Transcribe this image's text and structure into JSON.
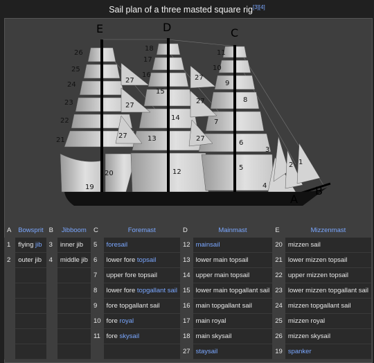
{
  "caption": {
    "text": "Sail plan of a three masted square rig",
    "refs": "[3][4]"
  },
  "diagram": {
    "mast_labels": [
      "E",
      "D",
      "C"
    ],
    "end_labels": [
      "A",
      "B"
    ],
    "sail_numbers": [
      "26",
      "25",
      "24",
      "23",
      "22",
      "21",
      "20",
      "19",
      "27",
      "27",
      "27",
      "18",
      "17",
      "16",
      "15",
      "14",
      "13",
      "12",
      "27",
      "27",
      "27",
      "11",
      "10",
      "9",
      "8",
      "7",
      "6",
      "5",
      "4",
      "3",
      "2",
      "1"
    ]
  },
  "table": {
    "headers": [
      {
        "letter": "A",
        "name": "Bowsprit"
      },
      {
        "letter": "B",
        "name": "Jibboom"
      },
      {
        "letter": "C",
        "name": "Foremast"
      },
      {
        "letter": "D",
        "name": "Mainmast"
      },
      {
        "letter": "E",
        "name": "Mizzenmast"
      }
    ],
    "rows": [
      [
        {
          "n": "1",
          "t": "flying",
          "l": "jib"
        },
        {
          "n": "3",
          "t": "inner jib"
        },
        {
          "n": "5",
          "t": "",
          "l": "foresail"
        },
        {
          "n": "12",
          "t": "",
          "l": "mainsail"
        },
        {
          "n": "20",
          "t": "mizzen sail"
        }
      ],
      [
        {
          "n": "2",
          "t": "outer jib"
        },
        {
          "n": "4",
          "t": "middle jib"
        },
        {
          "n": "6",
          "t": "lower fore",
          "l": "topsail"
        },
        {
          "n": "13",
          "t": "lower main topsail"
        },
        {
          "n": "21",
          "t": "lower mizzen topsail"
        }
      ],
      [
        null,
        null,
        {
          "n": "7",
          "t": "upper fore topsail"
        },
        {
          "n": "14",
          "t": "upper main topsail"
        },
        {
          "n": "22",
          "t": "upper mizzen topsail"
        }
      ],
      [
        null,
        null,
        {
          "n": "8",
          "t": "lower fore",
          "l": "topgallant sail"
        },
        {
          "n": "15",
          "t": "lower main topgallant sail"
        },
        {
          "n": "23",
          "t": "lower mizzen topgallant sail"
        }
      ],
      [
        null,
        null,
        {
          "n": "9",
          "t": "fore topgallant sail"
        },
        {
          "n": "16",
          "t": "main topgallant sail"
        },
        {
          "n": "24",
          "t": "mizzen topgallant sail"
        }
      ],
      [
        null,
        null,
        {
          "n": "10",
          "t": "fore",
          "l": "royal"
        },
        {
          "n": "17",
          "t": "main royal"
        },
        {
          "n": "25",
          "t": "mizzen royal"
        }
      ],
      [
        null,
        null,
        {
          "n": "11",
          "t": "fore",
          "l": "skysail"
        },
        {
          "n": "18",
          "t": "main skysail"
        },
        {
          "n": "26",
          "t": "mizzen skysail"
        }
      ],
      [
        null,
        null,
        null,
        {
          "n": "27",
          "t": "",
          "l": "staysail"
        },
        {
          "n": "19",
          "t": "",
          "l": "spanker"
        }
      ]
    ]
  }
}
